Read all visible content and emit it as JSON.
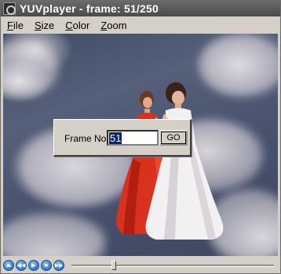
{
  "window": {
    "title": "YUVplayer - frame: 51/250",
    "icon": "yuvplayer-app-icon"
  },
  "menu": [
    {
      "label": "File",
      "accel": "F",
      "rest": "ile"
    },
    {
      "label": "Size",
      "accel": "S",
      "rest": "ize"
    },
    {
      "label": "Color",
      "accel": "C",
      "rest": "olor"
    },
    {
      "label": "Zoom",
      "accel": "Z",
      "rest": "oom"
    }
  ],
  "dialog": {
    "label": "Frame No",
    "input_value": "51",
    "go_label": "GO"
  },
  "playback": {
    "current_frame": 51,
    "total_frames": 250,
    "buttons": [
      "eject-icon",
      "rewind-icon",
      "play-icon",
      "stop-icon",
      "fast-forward-icon"
    ]
  },
  "colors": {
    "titlebar": "#4a4a4a",
    "selection": "#0a246a",
    "control_button": "#3d82cf"
  }
}
